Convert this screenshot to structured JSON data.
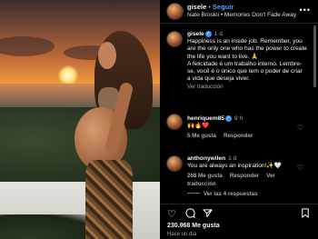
{
  "post": {
    "username": "gisele",
    "follow_label": "Seguir",
    "music": "Nate Broskii • Memories Don't Fade Away",
    "more_icon": "more-horizontal-icon"
  },
  "caption": {
    "username": "gisele",
    "time": "1 d",
    "text": "Happiness is an inside job. Remember, you are the only one who has the power to create the life you want to live. 🙏\nA felicidade é um trabalho interno. Lembre-se, você é o único que tem o poder de criar a vida que deseja viver.",
    "translate_label": "Ver traducción"
  },
  "comments": [
    {
      "username": "henriquem85",
      "time": "9 h",
      "text": "🙌🔥❤️",
      "likes": "5 Me gusta",
      "reply_label": "Responder"
    },
    {
      "username": "anthonywilen",
      "time": "1 d",
      "text": "You are always an inspiration!✨🤍",
      "likes": "268 Me gusta",
      "reply_label": "Responder",
      "translate_label": "Ver traducción",
      "view_replies": "Ver las 4 respuestas"
    }
  ],
  "footer": {
    "likes": "230.968 Me gusta",
    "time_ago": "Hace un día"
  },
  "icons": {
    "like": "heart-icon",
    "comment": "comment-icon",
    "share": "share-icon",
    "save": "bookmark-icon"
  }
}
